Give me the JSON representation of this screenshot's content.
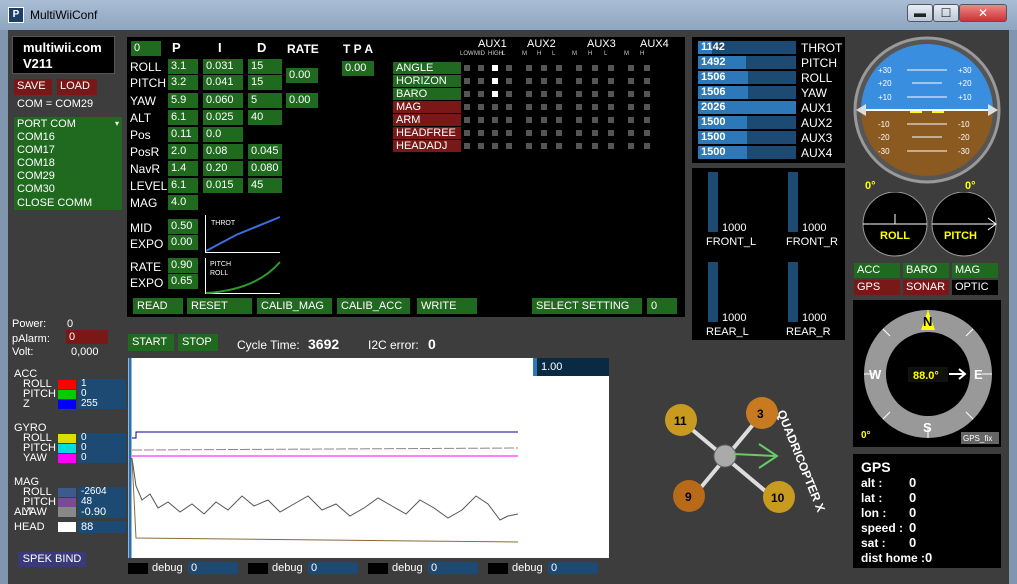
{
  "window": {
    "title": "MultiWiiConf",
    "icon": "P",
    "minimize": "▬",
    "maximize": "☐",
    "close": "✕"
  },
  "brand": {
    "name": "multiwii.com",
    "version": "V211"
  },
  "io": {
    "save": "SAVE",
    "load": "LOAD",
    "com_status": "COM = COM29",
    "port_header": "PORT COM",
    "ports": [
      "COM16",
      "COM17",
      "COM18",
      "COM29",
      "COM30"
    ],
    "close": "CLOSE COMM"
  },
  "power": {
    "power_label": "Power:",
    "power_value": "0",
    "alarm_label": "pAlarm:",
    "alarm_value": "0",
    "volt_label": "Volt:",
    "volt_value": "0,000"
  },
  "sensors": {
    "acc": {
      "label": "ACC",
      "rows": [
        {
          "name": "ROLL",
          "value": "1",
          "color": "#ff0000"
        },
        {
          "name": "PITCH",
          "value": "0",
          "color": "#00cc00"
        },
        {
          "name": "Z",
          "value": "255",
          "color": "#0000ff"
        }
      ]
    },
    "gyro": {
      "label": "GYRO",
      "rows": [
        {
          "name": "ROLL",
          "value": "0",
          "color": "#dddd00"
        },
        {
          "name": "PITCH",
          "value": "0",
          "color": "#00dddd"
        },
        {
          "name": "YAW",
          "value": "0",
          "color": "#ff00ff"
        }
      ]
    },
    "mag": {
      "label": "MAG",
      "rows": [
        {
          "name": "ROLL",
          "value": "-2604",
          "color": "#3c5a8c"
        },
        {
          "name": "PITCH",
          "value": "48",
          "color": "#7a4a9a"
        },
        {
          "name": "YAW",
          "value": "-424",
          "color": "#8a6a3a"
        }
      ]
    },
    "alt": {
      "label": "ALT",
      "value": "-0.90",
      "color": "#888888"
    },
    "head": {
      "label": "HEAD",
      "value": "88",
      "color": "#ffffff"
    }
  },
  "spek": "SPEK BIND",
  "pid": {
    "sel": "0",
    "h_p": "P",
    "h_i": "I",
    "h_d": "D",
    "h_rate": "RATE",
    "h_tpa": "T P A",
    "rows": [
      {
        "name": "ROLL",
        "p": "3.1",
        "i": "0.031",
        "d": "15"
      },
      {
        "name": "PITCH",
        "p": "3.2",
        "i": "0.041",
        "d": "15"
      },
      {
        "name": "YAW",
        "p": "5.9",
        "i": "0.060",
        "d": "5"
      },
      {
        "name": "ALT",
        "p": "6.1",
        "i": "0.025",
        "d": "40"
      },
      {
        "name": "Pos",
        "p": "0.11",
        "i": "0.0",
        "d": ""
      },
      {
        "name": "PosR",
        "p": "2.0",
        "i": "0.08",
        "d": "0.045"
      },
      {
        "name": "NavR",
        "p": "1.4",
        "i": "0.20",
        "d": "0.080"
      },
      {
        "name": "LEVEL",
        "p": "6.1",
        "i": "0.015",
        "d": "45"
      },
      {
        "name": "MAG",
        "p": "4.0",
        "i": "",
        "d": ""
      }
    ],
    "rate_rp": "0.00",
    "rate_yaw": "0.00",
    "tpa": "0.00",
    "mid_label": "MID",
    "mid": "0.50",
    "expo_label": "EXPO",
    "expo": "0.00",
    "thr_curve_label": "THROT",
    "rate_label": "RATE",
    "rate": "0.90",
    "expo2_label": "EXPO",
    "expo2": "0.65",
    "rc_curve_label1": "PITCH",
    "rc_curve_label2": "ROLL"
  },
  "actions": {
    "read": "READ",
    "reset": "RESET",
    "calib_mag": "CALIB_MAG",
    "calib_acc": "CALIB_ACC",
    "write": "WRITE",
    "select": "SELECT SETTING",
    "select_value": "0"
  },
  "aux": {
    "headers": [
      "AUX1",
      "AUX2",
      "AUX3",
      "AUX4"
    ],
    "sub": [
      "LOW",
      "MID",
      "HIGH",
      "L",
      "M",
      "H",
      "L",
      "M",
      "H",
      "L",
      "M",
      "H"
    ],
    "modes": [
      {
        "name": "ANGLE",
        "color": "#206a20",
        "on": [
          2
        ]
      },
      {
        "name": "HORIZON",
        "color": "#206a20",
        "on": [
          2
        ]
      },
      {
        "name": "BARO",
        "color": "#206a20",
        "on": [
          2
        ]
      },
      {
        "name": "MAG",
        "color": "#7a1818",
        "on": []
      },
      {
        "name": "ARM",
        "color": "#7a1818",
        "on": []
      },
      {
        "name": "HEADFREE",
        "color": "#7a1818",
        "on": []
      },
      {
        "name": "HEADADJ",
        "color": "#7a1818",
        "on": []
      }
    ]
  },
  "rc": [
    {
      "name": "THROT",
      "value": "1142",
      "level": 0.14
    },
    {
      "name": "PITCH",
      "value": "1492",
      "level": 0.49
    },
    {
      "name": "ROLL",
      "value": "1506",
      "level": 0.51
    },
    {
      "name": "YAW",
      "value": "1506",
      "level": 0.51
    },
    {
      "name": "AUX1",
      "value": "2026",
      "level": 1.0
    },
    {
      "name": "AUX2",
      "value": "1500",
      "level": 0.5
    },
    {
      "name": "AUX3",
      "value": "1500",
      "level": 0.5
    },
    {
      "name": "AUX4",
      "value": "1500",
      "level": 0.5
    }
  ],
  "motors": [
    {
      "name": "FRONT_L",
      "value": "1000"
    },
    {
      "name": "FRONT_R",
      "value": "1000"
    },
    {
      "name": "REAR_L",
      "value": "1000"
    },
    {
      "name": "REAR_R",
      "value": "1000"
    }
  ],
  "status": {
    "start": "START",
    "stop": "STOP",
    "cycle_label": "Cycle Time:",
    "cycle": "3692",
    "i2c_label": "I2C error:",
    "i2c": "0"
  },
  "graph": {
    "scale": "1.00"
  },
  "debug": [
    {
      "label": "debug",
      "value": "0"
    },
    {
      "label": "debug",
      "value": "0"
    },
    {
      "label": "debug",
      "value": "0"
    },
    {
      "label": "debug",
      "value": "0"
    }
  ],
  "quad": {
    "label": "QUADRICOPTER X",
    "motors": [
      "11",
      "3",
      "9",
      "10"
    ]
  },
  "horizon": {
    "ticks": [
      "+30",
      "+20",
      "+10",
      "-10",
      "-20",
      "-30"
    ],
    "roll_angle": "0°",
    "pitch_angle": "0°",
    "roll_label": "ROLL",
    "pitch_label": "PITCH"
  },
  "sensor_flags": {
    "acc": "ACC",
    "baro": "BARO",
    "mag": "MAG",
    "gps": "GPS",
    "sonar": "SONAR",
    "optic": "OPTIC"
  },
  "compass": {
    "n": "N",
    "e": "E",
    "s": "S",
    "w": "W",
    "heading": "88.0°",
    "angle": "0°",
    "fix": "GPS_fix"
  },
  "gps": {
    "title": "GPS",
    "alt_label": "alt :",
    "alt": "0",
    "lat_label": "lat :",
    "lat": "0",
    "lon_label": "lon :",
    "lon": "0",
    "speed_label": "speed :",
    "speed": "0",
    "sat_label": "sat :",
    "sat": "0",
    "dist_label": "dist home :",
    "dist": "0"
  }
}
